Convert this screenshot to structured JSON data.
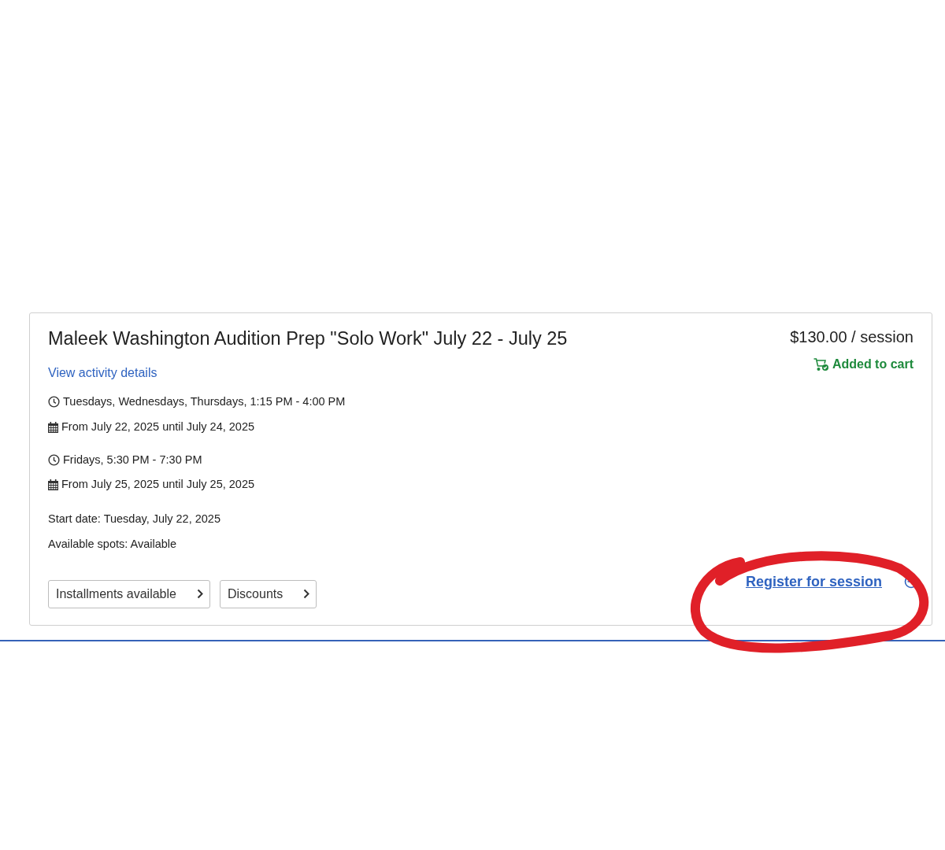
{
  "activity": {
    "title": "Maleek Washington Audition Prep \"Solo Work\" July 22 - July 25",
    "price": "$130.00 / session",
    "cart": {
      "label": "Added to cart",
      "added": true
    },
    "details_link": "View activity details",
    "schedules": [
      {
        "times": "Tuesdays, Wednesdays, Thursdays, 1:15 PM - 4:00 PM",
        "dates": "From July 22, 2025 until July 24, 2025"
      },
      {
        "times": "Fridays, 5:30 PM - 7:30 PM",
        "dates": "From July 25, 2025 until July 25, 2025"
      }
    ],
    "start_date": "Start date: Tuesday, July 22, 2025",
    "available_spots": "Available spots: Available",
    "options": [
      "Installments available",
      "Discounts"
    ],
    "register_link": "Register for session"
  }
}
